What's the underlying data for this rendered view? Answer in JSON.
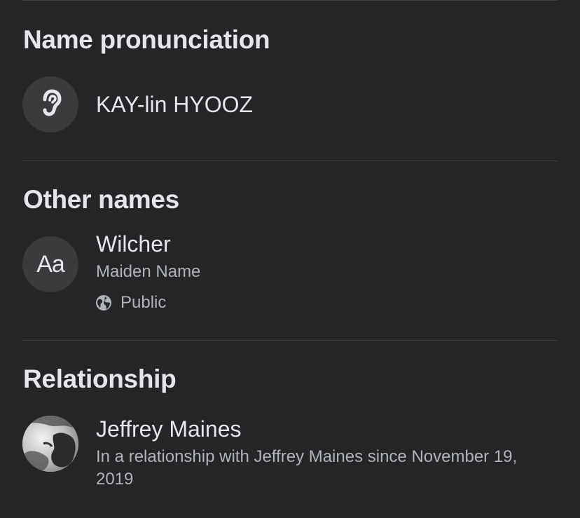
{
  "pronunciation": {
    "title": "Name pronunciation",
    "icon": "ear-icon",
    "value": "KAY-lin HYOOZ"
  },
  "other_names": {
    "title": "Other names",
    "icon_text": "Aa",
    "name": "Wilcher",
    "type": "Maiden Name",
    "privacy_icon": "globe-icon",
    "privacy": "Public"
  },
  "relationship": {
    "title": "Relationship",
    "partner": "Jeffrey Maines",
    "detail": "In a relationship with Jeffrey Maines since November 19, 2019"
  }
}
